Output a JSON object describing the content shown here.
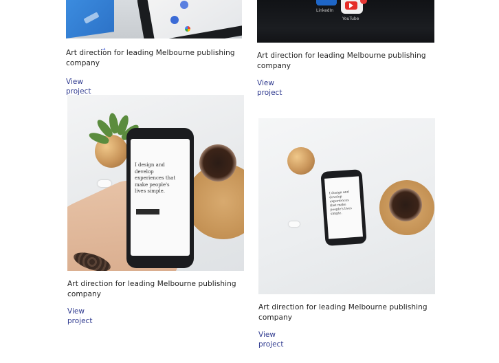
{
  "cards": [
    {
      "title": "Art direction for  leading Melbourne  publishing company",
      "link_label": "View project",
      "image_icon": "tablet-photo"
    },
    {
      "title": "Art direction for  leading Melbourne  publishing company",
      "link_label": "View project",
      "image_icon": "phone-apps-photo",
      "image_labels": [
        "LinkedIn",
        "YouTube"
      ]
    },
    {
      "title": "Art direction for  leading Melbourne  publishing company",
      "link_label": "View project",
      "image_icon": "hand-phone-photo",
      "phone_text": "I design and develop experiences that make people's lives simple."
    },
    {
      "title": "Art direction for  leading Melbourne  publishing company",
      "link_label": "View project",
      "image_icon": "table-phone-photo",
      "phone_text": "I design and develop experiences that make people's lives simple."
    }
  ],
  "colors": {
    "link": "#2f3a8f",
    "text": "#1e1e1e",
    "arrow": "#4a63d6"
  },
  "icons": {
    "cursor_arrow": "→"
  }
}
